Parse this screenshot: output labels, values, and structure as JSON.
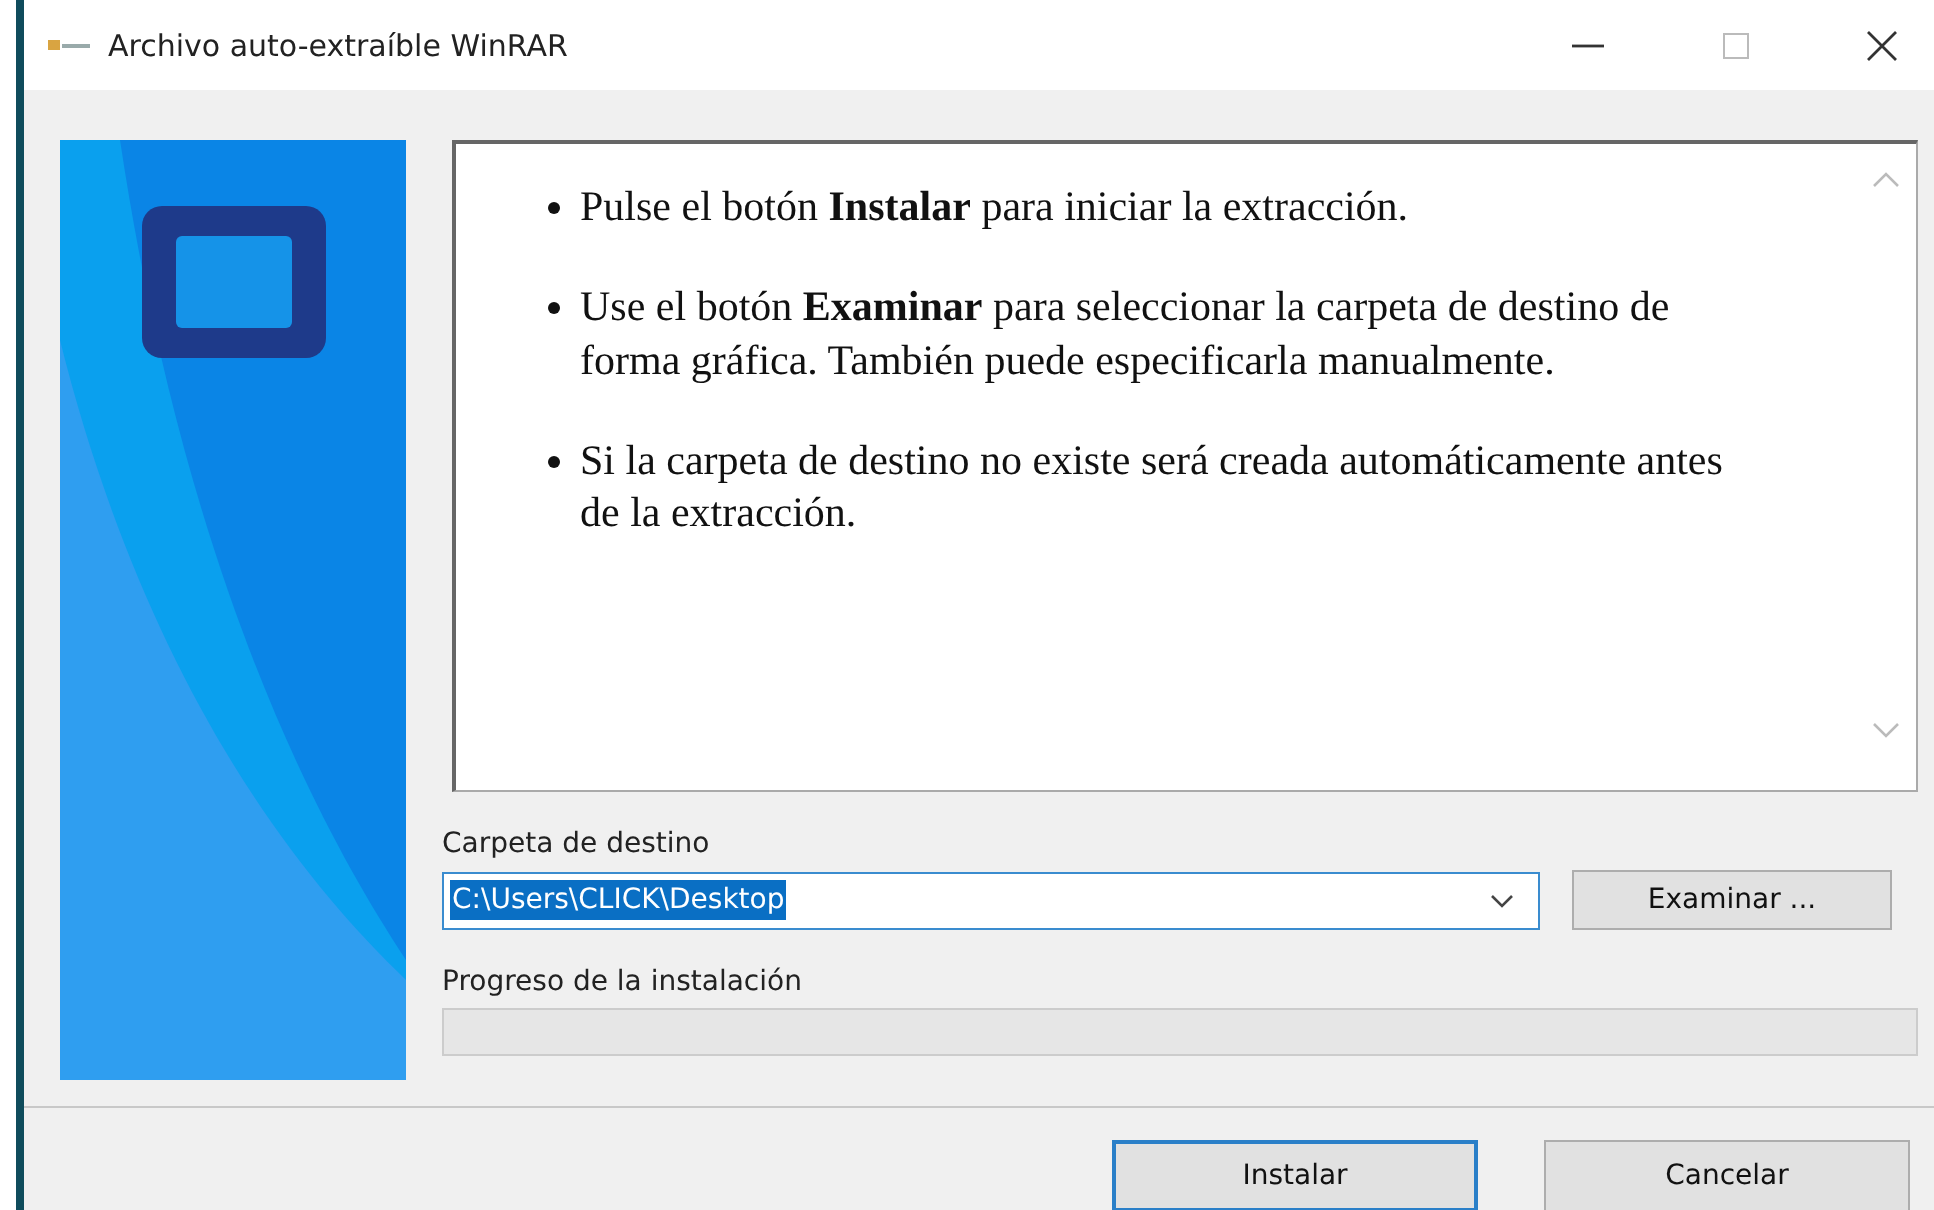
{
  "window": {
    "title": "Archivo auto-extraíble WinRAR"
  },
  "instructions": [
    "Pulse el botón **Instalar** para iniciar la extracción.",
    "Use el botón **Examinar** para seleccionar la carpeta de destino de forma gráfica. También puede especificarla manualmente.",
    "Si la carpeta de destino no existe será creada automáticamente antes de la extracción."
  ],
  "destination": {
    "label": "Carpeta de destino",
    "value": "C:\\Users\\CLICK\\Desktop",
    "value_selected": true,
    "browse_button": "Examinar ..."
  },
  "progress": {
    "label": "Progreso de la instalación",
    "level": 0
  },
  "buttons": [
    {
      "label": "Instalar",
      "default": true
    },
    {
      "label": "Cancelar",
      "default": false
    }
  ]
}
